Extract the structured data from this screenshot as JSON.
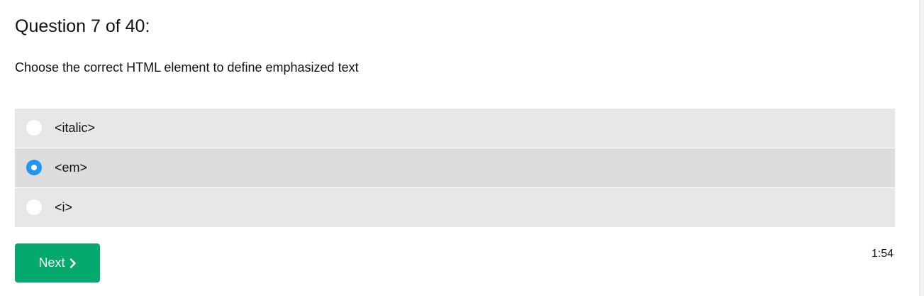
{
  "question": {
    "title": "Question 7 of 40:",
    "text": "Choose the correct HTML element to define emphasized text"
  },
  "options": [
    {
      "label": "<italic>",
      "selected": false
    },
    {
      "label": "<em>",
      "selected": true
    },
    {
      "label": "<i>",
      "selected": false
    }
  ],
  "next_button": {
    "label": "Next",
    "icon": "chevron-right-icon"
  },
  "timer": "1:54",
  "colors": {
    "option_bg": "#e7e7e9",
    "option_selected_bg": "#dddddd",
    "radio_selected": "#2196f3",
    "next_button_bg": "#04aa6d"
  }
}
